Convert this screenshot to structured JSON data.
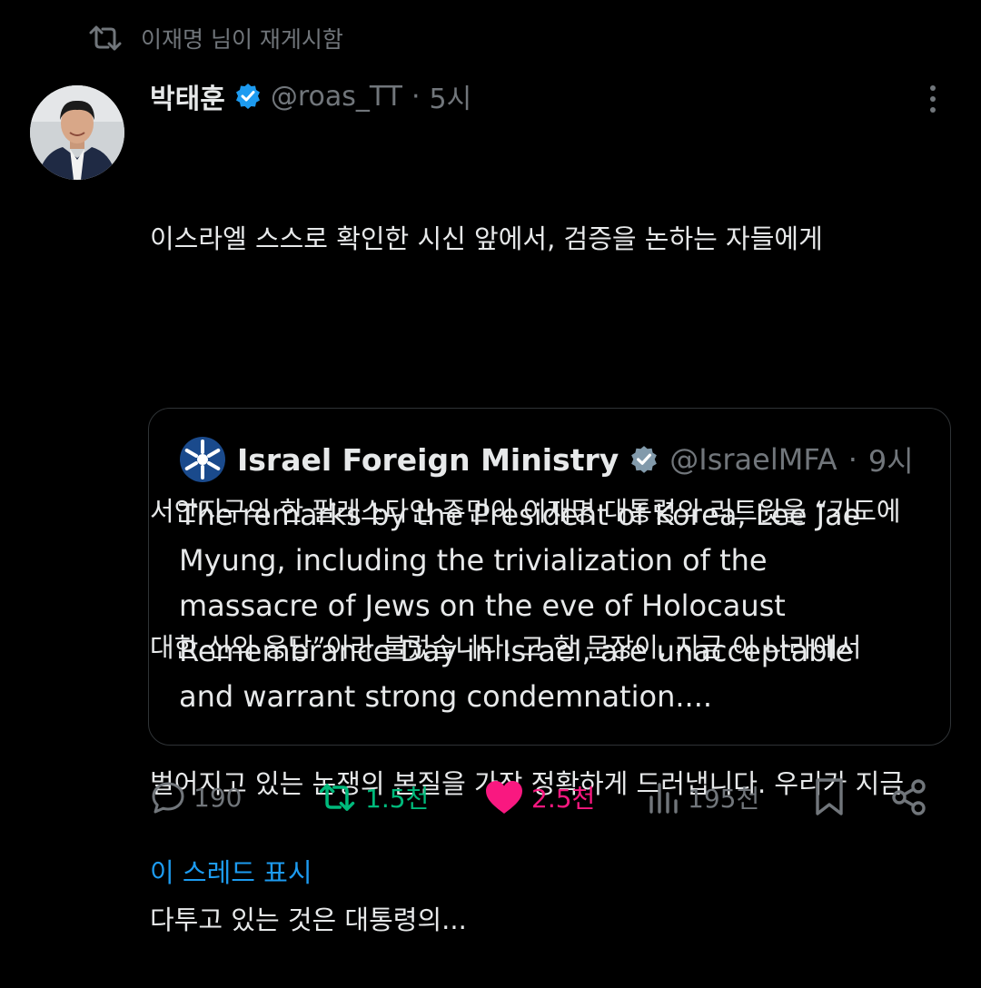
{
  "retweet_context": {
    "text": "이재명 님이 재게시함",
    "icon": "retweet-icon"
  },
  "tweet": {
    "author_name": "박태훈",
    "author_handle": "@roas_TT",
    "separator": "·",
    "time": "5시",
    "verified": true,
    "body_lines": [
      "이스라엘 스스로 확인한 시신 앞에서, 검증을 논하는 자들에게",
      "",
      "서안지구의 한 팔레스타인 주민이 이재명 대통령의 리트윗을 “기도에",
      "대한 신의 응답”이라 불렀습니다. 그 한 문장이, 지금 이 나라에서",
      "벌어지고 있는 논쟁의 본질을 가장 정확하게 드러냅니다. 우리가 지금",
      "다투고 있는 것은 대통령의..."
    ]
  },
  "quote": {
    "author_name": "Israel Foreign Ministry",
    "author_handle": "@IsraelMFA",
    "separator": "·",
    "time": "9시",
    "verified_badge_color": "#829aab",
    "body_lines": [
      "The remarks by the President of Korea, Lee Jae",
      "Myung, including the trivialization of the",
      "massacre of Jews on the eve of Holocaust",
      "Remembrance Day in Israel, are unacceptable",
      "and warrant strong condemnation...."
    ]
  },
  "actions": {
    "reply_count": "190",
    "retweet_count": "1.5천",
    "like_count": "2.5천",
    "views_count": "195천"
  },
  "show_thread": "이 스레드 표시",
  "colors": {
    "background": "#000000",
    "muted": "#71767b",
    "accent_blue": "#1d9bf0",
    "retweet_green": "#00ba7c",
    "like_pink": "#f91880"
  }
}
